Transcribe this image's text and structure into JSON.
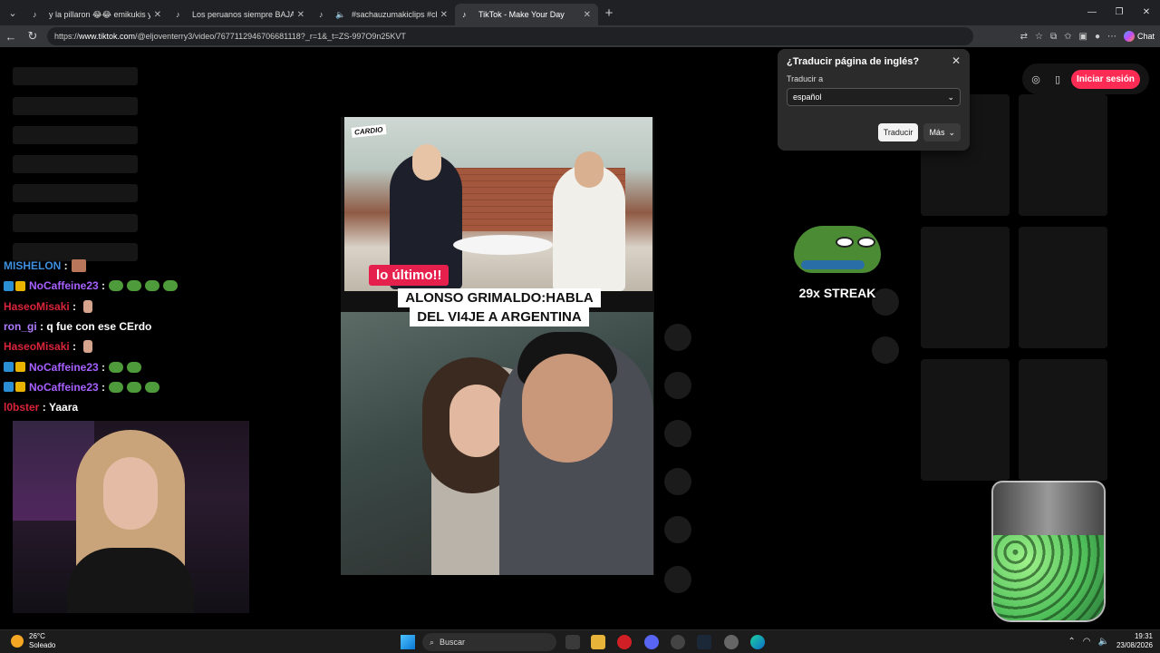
{
  "browser": {
    "tabs": [
      {
        "label": "y la pillaron 😂😂 emikukis y Nar",
        "active": false
      },
      {
        "label": "Los peruanos siempre BAJAMOS l",
        "active": false
      },
      {
        "label": "#sachauzumakiclips #chunny",
        "active": false
      },
      {
        "label": "TikTok - Make Your Day",
        "active": true
      }
    ],
    "url_prefix": "https://",
    "url_domain": "www.tiktok.com",
    "url_path": "/@eljoventerry3/video/7677112946706681118?_r=1&_t=ZS-997O9n25KVT",
    "chat_label": "Chat"
  },
  "translate_popup": {
    "title": "¿Traducir página de inglés?",
    "label": "Traducir a",
    "selected_language": "español",
    "translate_button": "Traducir",
    "more_button": "Más"
  },
  "tiktok": {
    "login_button": "Iniciar sesión",
    "video": {
      "brand_logo": "CARDIO",
      "tag": "lo último!!",
      "headline_line1": "ALONSO GRIMALDO:HABLA",
      "headline_line2": "DEL VI4JE A ARGENTINA"
    }
  },
  "overlay": {
    "streak_text": "29x STREAK"
  },
  "chat": [
    {
      "user": "MISHELON",
      "color": "#3d8fe0",
      "text": "",
      "badges": false,
      "emotes": "img"
    },
    {
      "user": "NoCaffeine23",
      "color": "#a660ff",
      "text": "",
      "badges": true,
      "emotes": "frog4"
    },
    {
      "user": "HaseoMisaki",
      "color": "#d9243a",
      "text": "",
      "badges": false,
      "emotes": "hand"
    },
    {
      "user": "ron_gi",
      "color": "#b07cff",
      "text": "q fue con ese CErdo",
      "badges": false,
      "emotes": ""
    },
    {
      "user": "HaseoMisaki",
      "color": "#d9243a",
      "text": "",
      "badges": false,
      "emotes": "hand"
    },
    {
      "user": "NoCaffeine23",
      "color": "#a660ff",
      "text": "",
      "badges": true,
      "emotes": "frog2"
    },
    {
      "user": "NoCaffeine23",
      "color": "#a660ff",
      "text": "",
      "badges": true,
      "emotes": "frog3"
    },
    {
      "user": "l0bster",
      "color": "#d9243a",
      "text": "Yaara",
      "badges": false,
      "emotes": ""
    }
  ],
  "taskbar": {
    "weather_temp": "26°C",
    "weather_desc": "Soleado",
    "search_label": "Buscar",
    "time": "19:31",
    "date": "23/08/2026"
  }
}
